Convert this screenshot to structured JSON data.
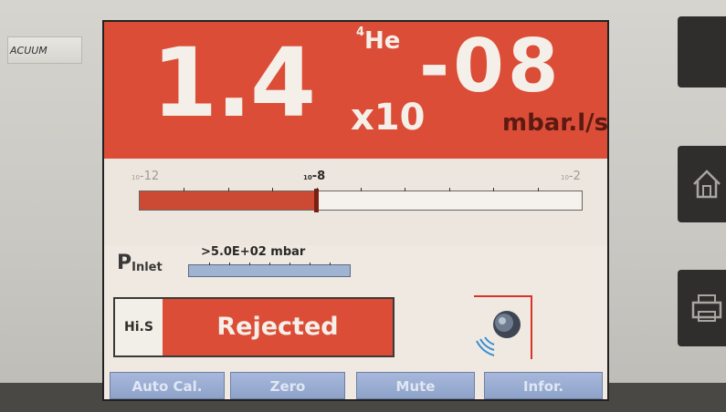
{
  "device": {
    "side_label": "ACUUM"
  },
  "display": {
    "gas": {
      "isotope": "4",
      "element": "He"
    },
    "mantissa": "1.4",
    "multiplier": "x10",
    "exponent": "-08",
    "unit": "mbar.l/s"
  },
  "scale": {
    "left_label": {
      "base": "10",
      "exp": "-12"
    },
    "mid_label": {
      "base": "10",
      "exp": "-8"
    },
    "right_label": {
      "base": "10",
      "exp": "-2"
    },
    "fill_fraction": 0.4
  },
  "inlet": {
    "label": "P",
    "label_sub": "Inlet",
    "value": ">5.0E+02 mbar"
  },
  "status": {
    "mode": "Hi.S",
    "result": "Rejected"
  },
  "softkeys": [
    "Auto Cal.",
    "Zero",
    "Mute",
    "Infor."
  ],
  "colors": {
    "reject_red": "#dc4d37",
    "screen_bg": "#efe9e2",
    "softkey_blue": "#9aaed4",
    "inlet_bar": "#9fb3d2"
  }
}
